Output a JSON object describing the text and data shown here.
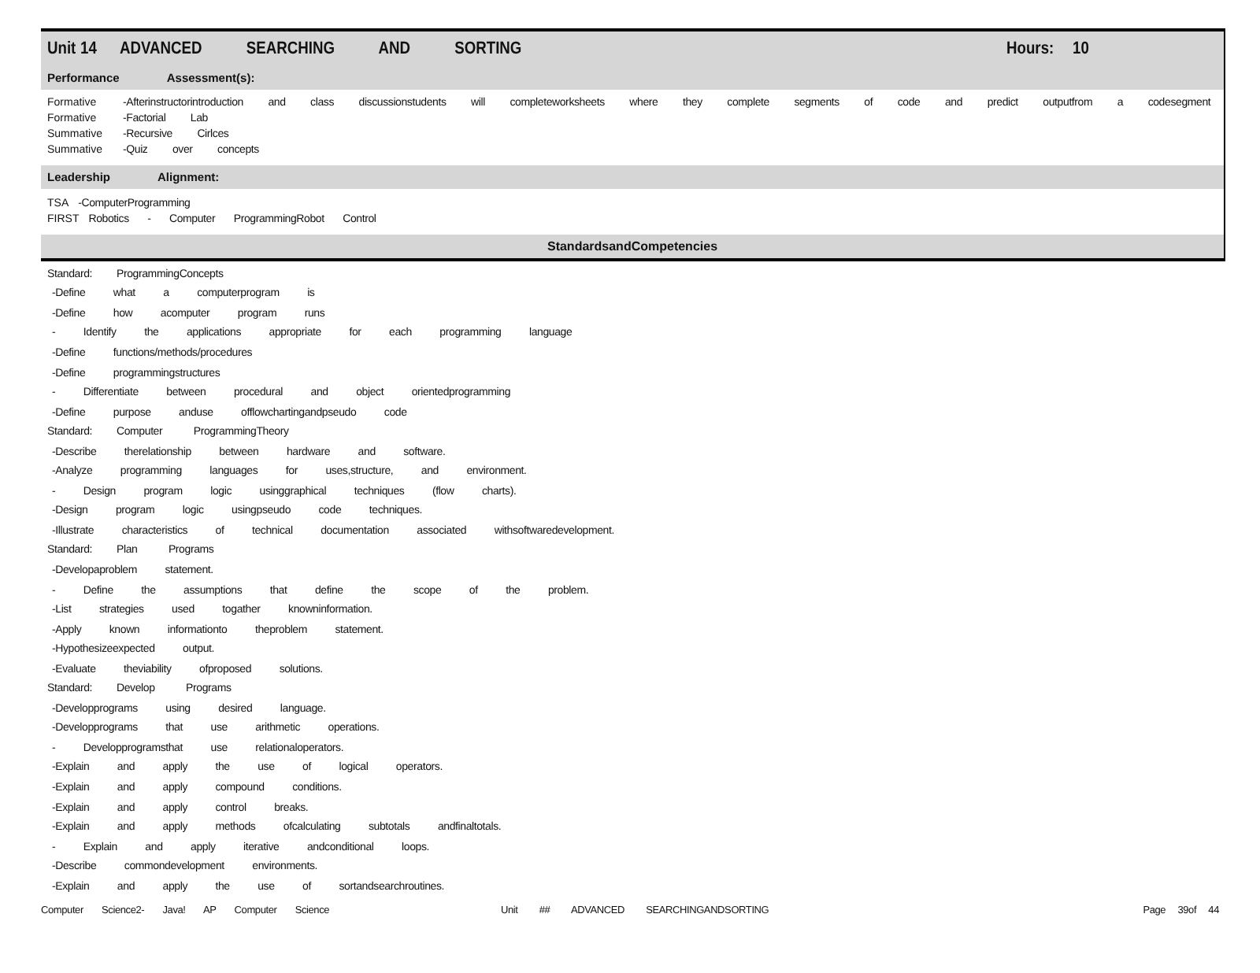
{
  "header": {
    "unit_label": "Unit",
    "unit_number": "14",
    "title": "ADVANCED SEARCHING AND SORTING",
    "hours_label": "Hours:",
    "hours": "10"
  },
  "performance": {
    "heading": [
      "Performance",
      "Assessment(s):"
    ],
    "rows": [
      {
        "type": "Formative",
        "text": "-Afterinstructorintroduction and class discussionstudents will completeworksheets where they complete segments of code and predict outputfrom a codesegment"
      },
      {
        "type": "Formative",
        "text": "-Factorial Lab"
      },
      {
        "type": "Summative",
        "text": "-Recursive Cirlces"
      },
      {
        "type": "Summative",
        "text": "-Quiz over concepts"
      }
    ]
  },
  "leadership": {
    "heading": [
      "Leadership",
      "Alignment:"
    ],
    "rows": [
      {
        "org": "TSA",
        "text": "-ComputerProgramming"
      },
      {
        "org": "FIRST",
        "text": "Robotics - Computer ProgrammingRobot Control"
      }
    ]
  },
  "standards": {
    "heading": "StandardsandCompetencies",
    "lines": [
      {
        "kind": "standard",
        "label": "Standard:",
        "text": "ProgrammingConcepts"
      },
      {
        "kind": "item",
        "text": "-Define what a computerprogram is"
      },
      {
        "kind": "item",
        "text": "-Define how acomputer program runs"
      },
      {
        "kind": "item",
        "text": "- Identify the applications appropriate for each programming language"
      },
      {
        "kind": "item",
        "text": "-Define functions/methods/procedures"
      },
      {
        "kind": "item",
        "text": "-Define programmingstructures"
      },
      {
        "kind": "item",
        "text": "- Differentiate between procedural and object orientedprogramming"
      },
      {
        "kind": "item",
        "text": "-Define purpose anduse offlowchartingandpseudo code"
      },
      {
        "kind": "standard",
        "label": "Standard:",
        "text": "Computer ProgrammingTheory"
      },
      {
        "kind": "item",
        "text": "-Describe therelationship between hardware and software."
      },
      {
        "kind": "item",
        "text": "-Analyze programming languages for uses,structure, and environment."
      },
      {
        "kind": "item",
        "text": "- Design program logic usinggraphical techniques (flow charts)."
      },
      {
        "kind": "item",
        "text": "-Design program logic usingpseudo code techniques."
      },
      {
        "kind": "item",
        "text": "-Illustrate characteristics of technical documentation associated withsoftwaredevelopment."
      },
      {
        "kind": "standard",
        "label": "Standard:",
        "text": "Plan Programs"
      },
      {
        "kind": "item",
        "text": "-Developaproblem statement."
      },
      {
        "kind": "item",
        "text": "- Define the assumptions that define the scope of the problem."
      },
      {
        "kind": "item",
        "text": "-List strategies used togather knowninformation."
      },
      {
        "kind": "item",
        "text": "-Apply known informationto theproblem statement."
      },
      {
        "kind": "item",
        "text": "-Hypothesizeexpected output."
      },
      {
        "kind": "item",
        "text": "-Evaluate theviability ofproposed solutions."
      },
      {
        "kind": "standard",
        "label": "Standard:",
        "text": "Develop Programs"
      },
      {
        "kind": "item",
        "text": "-Developprograms using desired language."
      },
      {
        "kind": "item",
        "text": "-Developprograms that use arithmetic operations."
      },
      {
        "kind": "item",
        "text": "- Developprogramsthat use relationaloperators."
      },
      {
        "kind": "item",
        "text": "-Explain and apply the use of logical operators."
      },
      {
        "kind": "item",
        "text": "-Explain and apply compound conditions."
      },
      {
        "kind": "item",
        "text": "-Explain and apply control breaks."
      },
      {
        "kind": "item",
        "text": "-Explain and apply methods ofcalculating subtotals andfinaltotals."
      },
      {
        "kind": "item",
        "text": "- Explain and apply iterative andconditional loops."
      },
      {
        "kind": "item",
        "text": "-Describe commondevelopment environments."
      },
      {
        "kind": "item",
        "text": "-Explain and apply the use of sortandsearchroutines."
      }
    ]
  },
  "footer": {
    "left": "Computer Science2- Java! AP Computer Science",
    "center": "Unit ## ADVANCED SEARCHINGANDSORTING",
    "right": "Page 39of 44"
  }
}
